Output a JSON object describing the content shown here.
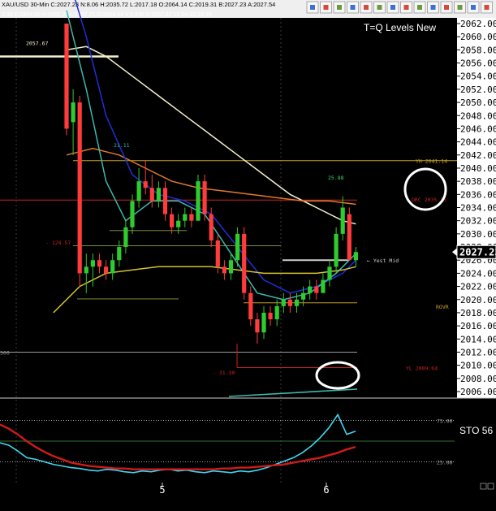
{
  "header": {
    "symbol": "XAU/USD",
    "interval": "30-Min",
    "ohlc_line": "XAU/USD 30-Min C:2027.23 N:8.06 H:2035.72 L:2017.18 O:2064.14 C:2019.31 B:2027.23 A:2027.54",
    "stats_line": "3.30 C:2864.99 H:2065.25 L:2057.71 O:2064.14 V:2,436 S:2057.67 12-04-23 24:15",
    "strategy_title": "T=Q Levels New"
  },
  "colors": {
    "background": "#000000",
    "bull_candle": "#2ecc2e",
    "bear_candle": "#ff3b3b",
    "axis_bg": "#ffffff",
    "ma_cream": "#f5efcc",
    "ma_orange": "#e07a2a",
    "ma_blue": "#1f2fd6",
    "ma_teal": "#3cb8b0",
    "ma_yellow": "#d4c232",
    "level_red": "#cc2222",
    "level_gold": "#c9a227",
    "sto_line": "#3fd6ef",
    "sto_signal": "#d11b1b"
  },
  "chart_data": [
    {
      "type": "candlestick",
      "title": "T=Q Levels New",
      "y_axis": {
        "min": 2006,
        "max": 2062,
        "ticks": [
          "2062.00",
          "2060.00",
          "2058.00",
          "2056.00",
          "2054.00",
          "2052.00",
          "2050.00",
          "2048.00",
          "2046.00",
          "2044.00",
          "2042.00",
          "2040.00",
          "2038.00",
          "2036.00",
          "2034.00",
          "2032.00",
          "2030.00",
          "2028.00",
          "2026.00",
          "2024.00",
          "2022.00",
          "2020.00",
          "2018.00",
          "2016.00",
          "2014.00",
          "2012.00",
          "2010.00",
          "2008.00",
          "2006.00"
        ],
        "current_price_label": "2027.23"
      },
      "x_axis": {
        "labels": [
          "5",
          "6"
        ]
      },
      "candles": [
        {
          "o": 2064,
          "h": 2064,
          "l": 2045,
          "c": 2046
        },
        {
          "o": 2047,
          "h": 2052,
          "l": 2042,
          "c": 2050
        },
        {
          "o": 2050,
          "h": 2051,
          "l": 2022,
          "c": 2024
        },
        {
          "o": 2024,
          "h": 2027,
          "l": 2021,
          "c": 2025
        },
        {
          "o": 2025,
          "h": 2027,
          "l": 2022,
          "c": 2026
        },
        {
          "o": 2026,
          "h": 2027,
          "l": 2024,
          "c": 2025
        },
        {
          "o": 2025,
          "h": 2026,
          "l": 2023,
          "c": 2024
        },
        {
          "o": 2024,
          "h": 2027,
          "l": 2023,
          "c": 2026
        },
        {
          "o": 2026,
          "h": 2029,
          "l": 2025,
          "c": 2028
        },
        {
          "o": 2028,
          "h": 2032,
          "l": 2027,
          "c": 2031
        },
        {
          "o": 2031,
          "h": 2036,
          "l": 2030,
          "c": 2035
        },
        {
          "o": 2035,
          "h": 2040,
          "l": 2034,
          "c": 2038
        },
        {
          "o": 2038,
          "h": 2041.11,
          "l": 2036,
          "c": 2037
        },
        {
          "o": 2037,
          "h": 2039,
          "l": 2034,
          "c": 2035
        },
        {
          "o": 2035,
          "h": 2038,
          "l": 2034,
          "c": 2037
        },
        {
          "o": 2037,
          "h": 2038,
          "l": 2032,
          "c": 2033
        },
        {
          "o": 2033,
          "h": 2034,
          "l": 2030,
          "c": 2031
        },
        {
          "o": 2031,
          "h": 2033,
          "l": 2030,
          "c": 2032
        },
        {
          "o": 2032,
          "h": 2034,
          "l": 2031,
          "c": 2033
        },
        {
          "o": 2033,
          "h": 2034,
          "l": 2031,
          "c": 2032
        },
        {
          "o": 2032,
          "h": 2039,
          "l": 2032,
          "c": 2038
        },
        {
          "o": 2038,
          "h": 2039,
          "l": 2032,
          "c": 2033
        },
        {
          "o": 2033,
          "h": 2034,
          "l": 2028,
          "c": 2029
        },
        {
          "o": 2029,
          "h": 2030,
          "l": 2024,
          "c": 2025
        },
        {
          "o": 2025,
          "h": 2026,
          "l": 2023,
          "c": 2024
        },
        {
          "o": 2024,
          "h": 2027,
          "l": 2023,
          "c": 2026
        },
        {
          "o": 2026,
          "h": 2031,
          "l": 2025,
          "c": 2030
        },
        {
          "o": 2030,
          "h": 2031,
          "l": 2020,
          "c": 2021
        },
        {
          "o": 2021,
          "h": 2022,
          "l": 2016,
          "c": 2017
        },
        {
          "o": 2017,
          "h": 2018,
          "l": 2013.3,
          "c": 2015
        },
        {
          "o": 2015,
          "h": 2019,
          "l": 2014,
          "c": 2018
        },
        {
          "o": 2018,
          "h": 2019,
          "l": 2016,
          "c": 2017
        },
        {
          "o": 2017,
          "h": 2020,
          "l": 2016,
          "c": 2019
        },
        {
          "o": 2019,
          "h": 2021,
          "l": 2018,
          "c": 2020
        },
        {
          "o": 2020,
          "h": 2021,
          "l": 2018,
          "c": 2019
        },
        {
          "o": 2019,
          "h": 2021,
          "l": 2018,
          "c": 2020
        },
        {
          "o": 2020,
          "h": 2022,
          "l": 2019,
          "c": 2021
        },
        {
          "o": 2021,
          "h": 2023,
          "l": 2020,
          "c": 2022
        },
        {
          "o": 2022,
          "h": 2023,
          "l": 2020,
          "c": 2021
        },
        {
          "o": 2021,
          "h": 2024,
          "l": 2021,
          "c": 2023
        },
        {
          "o": 2023,
          "h": 2026,
          "l": 2022,
          "c": 2025
        },
        {
          "o": 2025,
          "h": 2031,
          "l": 2024,
          "c": 2030
        },
        {
          "o": 2030,
          "h": 2035.72,
          "l": 2029,
          "c": 2034
        },
        {
          "o": 2033,
          "h": 2034,
          "l": 2026,
          "c": 2026
        },
        {
          "o": 2026,
          "h": 2028,
          "l": 2025,
          "c": 2027.23
        }
      ],
      "moving_averages": [
        {
          "color": "#f5efcc",
          "points": [
            [
              0,
              2058
            ],
            [
              3,
              2058.5
            ],
            [
              6,
              2057
            ],
            [
              10,
              2054
            ],
            [
              14,
              2051
            ],
            [
              18,
              2048
            ],
            [
              22,
              2045
            ],
            [
              26,
              2042
            ],
            [
              30,
              2039
            ],
            [
              34,
              2036
            ],
            [
              38,
              2034
            ],
            [
              42,
              2032
            ],
            [
              44,
              2031.5
            ]
          ]
        },
        {
          "color": "#e07a2a",
          "points": [
            [
              0,
              2042
            ],
            [
              4,
              2043
            ],
            [
              8,
              2042
            ],
            [
              12,
              2040
            ],
            [
              16,
              2038
            ],
            [
              20,
              2037
            ],
            [
              24,
              2036.5
            ],
            [
              28,
              2036
            ],
            [
              32,
              2035.5
            ],
            [
              36,
              2035
            ],
            [
              40,
              2035
            ],
            [
              44,
              2034.5
            ]
          ]
        },
        {
          "color": "#1f2fd6",
          "points": [
            [
              0,
              2070
            ],
            [
              3,
              2060
            ],
            [
              6,
              2048
            ],
            [
              10,
              2039
            ],
            [
              14,
              2036
            ],
            [
              18,
              2035
            ],
            [
              22,
              2033
            ],
            [
              26,
              2028
            ],
            [
              30,
              2023
            ],
            [
              34,
              2021
            ],
            [
              38,
              2022
            ],
            [
              42,
              2024
            ],
            [
              44,
              2026
            ]
          ]
        },
        {
          "color": "#3cb8b0",
          "points": [
            [
              0,
              2064
            ],
            [
              3,
              2052
            ],
            [
              6,
              2038
            ],
            [
              9,
              2032
            ],
            [
              13,
              2035
            ],
            [
              17,
              2035
            ],
            [
              21,
              2033
            ],
            [
              25,
              2027
            ],
            [
              29,
              2021
            ],
            [
              33,
              2020
            ],
            [
              37,
              2021
            ],
            [
              41,
              2024
            ],
            [
              44,
              2027
            ]
          ]
        },
        {
          "color": "#d4c232",
          "points": [
            [
              -2,
              2018
            ],
            [
              2,
              2022
            ],
            [
              6,
              2024
            ],
            [
              10,
              2024.5
            ],
            [
              14,
              2025
            ],
            [
              18,
              2025
            ],
            [
              22,
              2025
            ],
            [
              26,
              2024.5
            ],
            [
              30,
              2024
            ],
            [
              34,
              2024
            ],
            [
              38,
              2024
            ],
            [
              42,
              2024.5
            ],
            [
              44,
              2025
            ]
          ]
        }
      ],
      "levels": [
        {
          "price": 2057,
          "label": "2057.67",
          "color": "#f5efcc"
        },
        {
          "price": 2041.14,
          "label": "YH 2041.14",
          "color": "#c9a227"
        },
        {
          "price": 2035.15,
          "label": "ORC 2035.15",
          "color": "#cc2222"
        },
        {
          "price": 2026,
          "label": "Yest Mid",
          "color": "#cfcfcf"
        },
        {
          "price": 2019.5,
          "label": "ROVR",
          "color": "#c9a227"
        },
        {
          "price": 2012,
          "label": "500",
          "color": "#9a9a9a"
        },
        {
          "price": 2009.64,
          "label": "YL 2009.64",
          "color": "#cc2222"
        }
      ],
      "annotations": [
        "21.11",
        "25.88",
        "- 124.57",
        "- 31.30"
      ]
    },
    {
      "type": "line",
      "title": "STO 56",
      "y_axis": {
        "min": 0,
        "max": 100,
        "ticks": [
          "75.00",
          "25.00"
        ]
      },
      "series": [
        {
          "values": [
            48,
            45,
            38,
            30,
            28,
            25,
            22,
            20,
            18,
            17,
            15,
            14,
            16,
            15,
            13,
            12,
            14,
            13,
            15,
            16,
            14,
            15,
            13,
            12,
            14,
            13,
            12,
            14,
            13,
            15,
            18,
            22,
            26,
            30,
            36,
            44,
            54,
            66,
            82,
            58,
            62
          ]
        },
        {
          "values": [
            70,
            65,
            58,
            50,
            43,
            37,
            32,
            28,
            24,
            22,
            20,
            19,
            18,
            17,
            17,
            16,
            16,
            16,
            16,
            16,
            16,
            16,
            16,
            16,
            16,
            17,
            17,
            18,
            18,
            19,
            20,
            21,
            22,
            24,
            26,
            28,
            30,
            33,
            36,
            40,
            43
          ]
        }
      ]
    }
  ]
}
